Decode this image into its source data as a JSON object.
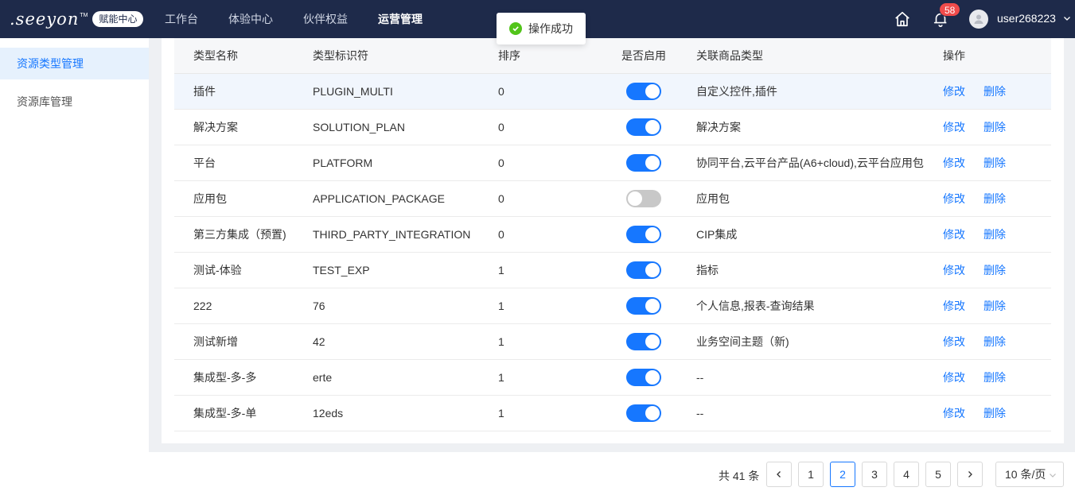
{
  "header": {
    "logo_text": ".seeyon",
    "logo_tm": "TM",
    "logo_badge": "赋能中心",
    "nav": [
      {
        "label": "工作台"
      },
      {
        "label": "体验中心"
      },
      {
        "label": "伙伴权益"
      },
      {
        "label": "运营管理"
      }
    ],
    "active_nav": "运营管理",
    "notification_count": "58",
    "username": "user268223"
  },
  "toast": {
    "text": "操作成功",
    "type": "success"
  },
  "sidebar": {
    "items": [
      {
        "label": "资源类型管理",
        "active": true
      },
      {
        "label": "资源库管理",
        "active": false
      }
    ]
  },
  "table": {
    "columns": [
      "类型名称",
      "类型标识符",
      "排序",
      "是否启用",
      "关联商品类型",
      "操作"
    ],
    "edit_label": "修改",
    "delete_label": "删除",
    "rows": [
      {
        "name": "插件",
        "code": "PLUGIN_MULTI",
        "order": "0",
        "enabled": true,
        "related": "自定义控件,插件"
      },
      {
        "name": "解决方案",
        "code": "SOLUTION_PLAN",
        "order": "0",
        "enabled": true,
        "related": "解决方案"
      },
      {
        "name": "平台",
        "code": "PLATFORM",
        "order": "0",
        "enabled": true,
        "related": "协同平台,云平台产品(A6+cloud),云平台应用包"
      },
      {
        "name": "应用包",
        "code": "APPLICATION_PACKAGE",
        "order": "0",
        "enabled": false,
        "related": "应用包"
      },
      {
        "name": "第三方集成（预置)",
        "code": "THIRD_PARTY_INTEGRATION",
        "order": "0",
        "enabled": true,
        "related": "CIP集成"
      },
      {
        "name": "测试-体验",
        "code": "TEST_EXP",
        "order": "1",
        "enabled": true,
        "related": "指标"
      },
      {
        "name": "222",
        "code": "76",
        "order": "1",
        "enabled": true,
        "related": "个人信息,报表-查询结果"
      },
      {
        "name": "测试新增",
        "code": "42",
        "order": "1",
        "enabled": true,
        "related": "业务空间主题（新)"
      },
      {
        "name": "集成型-多-多",
        "code": "erte",
        "order": "1",
        "enabled": true,
        "related": "--"
      },
      {
        "name": "集成型-多-单",
        "code": "12eds",
        "order": "1",
        "enabled": true,
        "related": "--"
      }
    ]
  },
  "pagination": {
    "total_text": "共 41 条",
    "pages": [
      "1",
      "2",
      "3",
      "4",
      "5"
    ],
    "current_page": "2",
    "page_size": "10 条/页"
  },
  "colors": {
    "navbar": "#1e2a4a",
    "accent": "#1677ff",
    "badge": "#f04b4b",
    "success": "#52c41a"
  }
}
